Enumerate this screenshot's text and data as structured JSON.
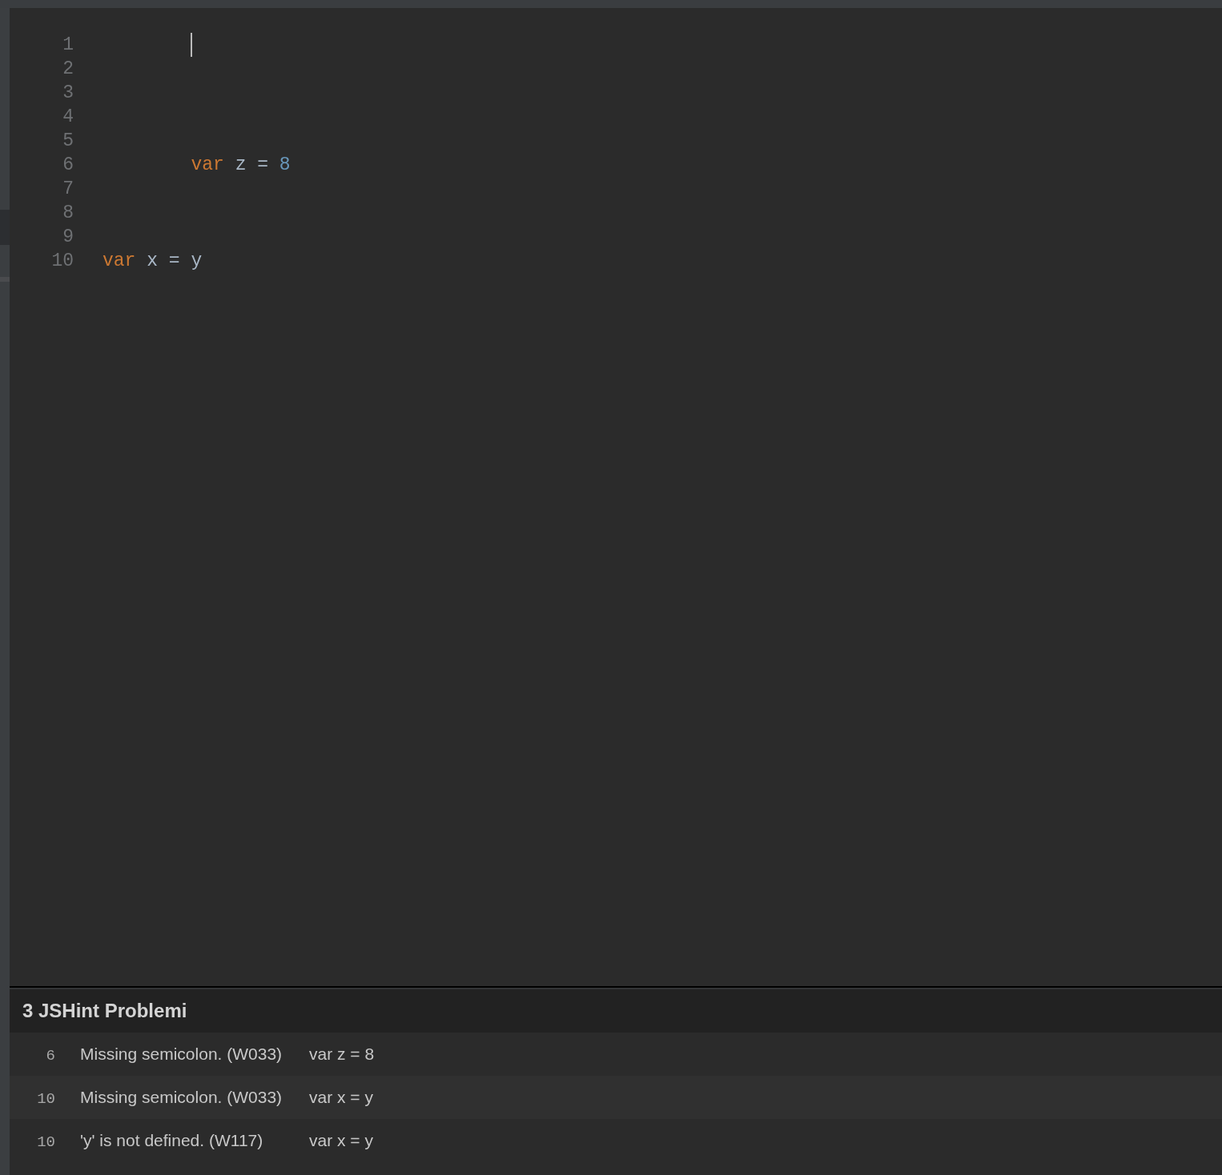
{
  "editor": {
    "lines": [
      {
        "number": "1",
        "indented": true,
        "cursor": true
      },
      {
        "number": "2"
      },
      {
        "number": "3"
      },
      {
        "number": "4"
      },
      {
        "number": "5"
      },
      {
        "number": "6",
        "indented": true,
        "tokens": [
          {
            "kind": "keyword",
            "text": "var"
          },
          {
            "kind": "plain",
            "text": " z = "
          },
          {
            "kind": "number",
            "text": "8"
          }
        ]
      },
      {
        "number": "7"
      },
      {
        "number": "8"
      },
      {
        "number": "9"
      },
      {
        "number": "10",
        "indented": false,
        "tokens": [
          {
            "kind": "keyword",
            "text": "var"
          },
          {
            "kind": "plain",
            "text": " x = y"
          }
        ]
      }
    ]
  },
  "problems_panel": {
    "title": "3 JSHint Problemi",
    "problems": [
      {
        "line": "6",
        "message": "Missing semicolon. (W033)",
        "code": "var z = 8"
      },
      {
        "line": "10",
        "message": "Missing semicolon. (W033)",
        "code": "var x = y"
      },
      {
        "line": "10",
        "message": "'y' is not defined. (W117)",
        "code": "var x = y"
      }
    ]
  }
}
